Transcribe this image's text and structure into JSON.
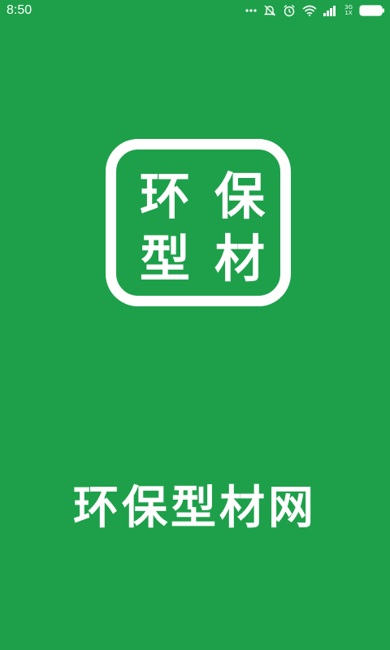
{
  "status_bar": {
    "time": "8:50",
    "network_top": "3G",
    "network_bottom": "1X",
    "icons": [
      "more-dots-icon",
      "mute-icon",
      "alarm-icon",
      "wifi-icon",
      "signal-icon",
      "battery-icon"
    ]
  },
  "logo": {
    "chars": [
      "环",
      "保",
      "型",
      "材"
    ]
  },
  "app_name": "环保型材网",
  "colors": {
    "background": "#1ea04a",
    "foreground": "#ffffff"
  }
}
